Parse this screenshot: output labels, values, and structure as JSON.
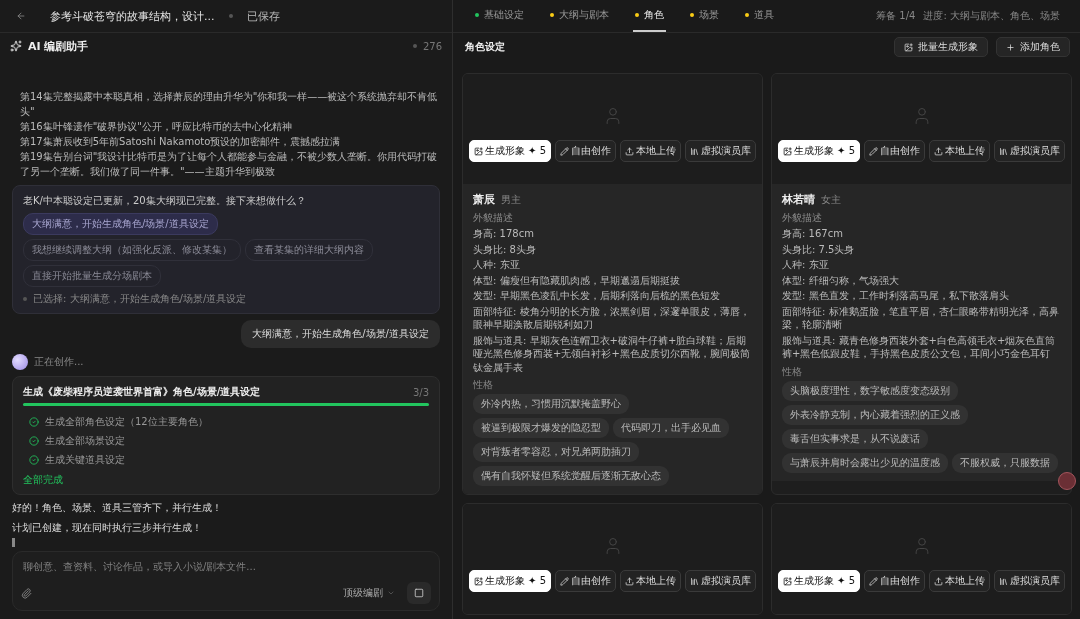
{
  "topbar": {
    "title": "参考斗破苍穹的故事结构，设计...",
    "status": "已保存"
  },
  "assistant": {
    "title": "AI 编剧助手",
    "count": "276"
  },
  "outline_lines": [
    "第14集完整揭露中本聪真相，选择萧辰的理由升华为\"你和我一样——被这个系统抛弃却不肯低头\"",
    "第16集叶锋遗作\"破界协议\"公开，呼应比特币的去中心化精神",
    "第17集萧辰收到5年前Satoshi Nakamoto预设的加密邮件，震撼感拉满",
    "第19集告别台词\"我设计比特币是为了让每个人都能参与金融，不被少数人垄断。你用代码打破了另一个垄断。我们做了同一件事。\"——主题升华到极致"
  ],
  "question": {
    "text": "老K/中本聪设定已更新，20集大纲现已完整。接下来想做什么？",
    "options": [
      {
        "label": "大纲满意，开始生成角色/场景/道具设定",
        "selected": true
      },
      {
        "label": "我想继续调整大纲（如强化反派、修改某集）",
        "selected": false
      },
      {
        "label": "查看某集的详细大纲内容",
        "selected": false
      },
      {
        "label": "直接开始批量生成分场剧本",
        "selected": false
      }
    ],
    "chosen": "已选择: 大纲满意，开始生成角色/场景/道具设定"
  },
  "user_message": "大纲满意，开始生成角色/场景/道具设定",
  "working": "正在创作...",
  "task": {
    "title": "生成《废柴程序员逆袭世界首富》角色/场景/道具设定",
    "count": "3/3",
    "level": 1,
    "steps": [
      {
        "label": "生成全部角色设定（12位主要角色）",
        "done": true
      },
      {
        "label": "生成全部场景设定",
        "done": true
      },
      {
        "label": "生成关键道具设定",
        "done": true
      }
    ],
    "footer": "全部完成"
  },
  "replies": [
    "好的！角色、场景、道具三管齐下，并行生成！",
    "计划已创建，现在同时执行三步并行生成！"
  ],
  "composer": {
    "placeholder": "聊创意、查资料、讨论作品，或导入小说/剧本文件...",
    "model": "顶级编剧"
  },
  "tabs": [
    {
      "label": "基础设定",
      "selected": false,
      "color": "#22c55e"
    },
    {
      "label": "大纲与剧本",
      "selected": false,
      "color": "#facc15"
    },
    {
      "label": "角色",
      "selected": true,
      "color": "#facc15"
    },
    {
      "label": "场景",
      "selected": false,
      "color": "#facc15"
    },
    {
      "label": "道具",
      "selected": false,
      "color": "#facc15"
    }
  ],
  "progress": {
    "stage": "筹备 1/4",
    "detail": "进度: 大纲与剧本、角色、场景"
  },
  "section": {
    "title": "角色设定",
    "actions": [
      {
        "label": "批量生成形象",
        "kind": "batch"
      },
      {
        "label": "添加角色",
        "kind": "add"
      }
    ]
  },
  "characters": [
    {
      "buttons": [
        {
          "label": "生成形象 ✦ 5",
          "kind": "primary"
        },
        {
          "label": "自由创作",
          "kind": "pen"
        },
        {
          "label": "本地上传",
          "kind": "upload"
        },
        {
          "label": "虚拟演员库",
          "kind": "library"
        }
      ],
      "name": "萧辰",
      "role": "男主",
      "appearance_label": "外貌描述",
      "lines": [
        "身高: 178cm",
        "头身比: 8头身",
        "人种: 东亚",
        "体型: 偏瘦但有隐藏肌肉感，早期邋遢后期挺拔",
        "发型: 早期黑色凌乱中长发，后期利落向后梳的黑色短发",
        "面部特征: 棱角分明的长方脸，浓黑剑眉，深邃单眼皮，薄唇，眼神早期涣散后期锐利如刀",
        "服饰与道具: 早期灰色连帽卫衣+破洞牛仔裤+脏白球鞋；后期哑光黑色修身西装+无领白衬衫+黑色皮质切尔西靴，腕间极简钛金属手表"
      ],
      "traits_label": "性格",
      "traits": [
        "外冷内热，习惯用沉默掩盖野心",
        "被逼到极限才爆发的隐忍型",
        "代码即刀，出手必见血",
        "对背叛者零容忍，对兄弟两肋插刀",
        "偶有自我怀疑但系统觉醒后逐渐无敌心态"
      ]
    },
    {
      "buttons": [
        {
          "label": "生成形象 ✦ 5",
          "kind": "primary"
        },
        {
          "label": "自由创作",
          "kind": "pen"
        },
        {
          "label": "本地上传",
          "kind": "upload"
        },
        {
          "label": "虚拟演员库",
          "kind": "library"
        }
      ],
      "name": "林若晴",
      "role": "女主",
      "appearance_label": "外貌描述",
      "lines": [
        "身高: 167cm",
        "头身比: 7.5头身",
        "人种: 东亚",
        "体型: 纤细匀称，气场强大",
        "发型: 黑色直发，工作时利落高马尾，私下散落肩头",
        "面部特征: 标准鹅蛋脸，笔直平眉，杏仁眼略带精明光泽，高鼻梁，轮廓清晰",
        "服饰与道具: 藏青色修身西装外套+白色高领毛衣+烟灰色直筒裤+黑色低跟皮鞋，手持黑色皮质公文包，耳间小巧金色耳钉"
      ],
      "traits_label": "性格",
      "traits": [
        "头脑极度理性，数字敏感度变态级别",
        "外表冷静克制，内心藏着强烈的正义感",
        "毒舌但实事求是，从不说废话",
        "与萧辰并肩时会露出少见的温度感",
        "不服权威，只服数据"
      ]
    },
    {
      "buttons": [
        {
          "label": "生成形象 ✦ 5",
          "kind": "primary"
        },
        {
          "label": "自由创作",
          "kind": "pen"
        },
        {
          "label": "本地上传",
          "kind": "upload"
        },
        {
          "label": "虚拟演员库",
          "kind": "library"
        }
      ]
    },
    {
      "buttons": [
        {
          "label": "生成形象 ✦ 5",
          "kind": "primary"
        },
        {
          "label": "自由创作",
          "kind": "pen"
        },
        {
          "label": "本地上传",
          "kind": "upload"
        },
        {
          "label": "虚拟演员库",
          "kind": "library"
        }
      ]
    }
  ]
}
